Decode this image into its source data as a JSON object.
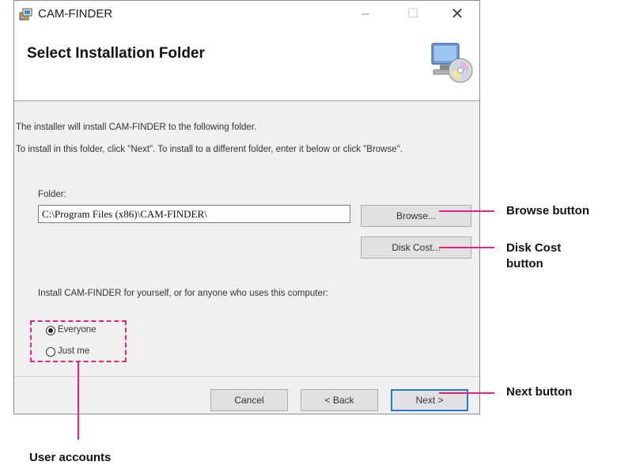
{
  "window": {
    "title": "CAM-FINDER",
    "controls": {
      "minimize": "–",
      "maximize": "☐",
      "close": "✕"
    }
  },
  "header": {
    "title": "Select Installation Folder",
    "icon": "setup-disc-icon"
  },
  "body": {
    "intro_line": "The installer will install CAM-FINDER to the following folder.",
    "instructions_line": "To install in this folder, click \"Next\". To install to a different folder, enter it below or click \"Browse\".",
    "folder_label": "Folder:",
    "folder_value": "C:\\Program Files (x86)\\CAM-FINDER\\",
    "browse_label": "Browse...",
    "disk_cost_label": "Disk Cost...",
    "install_for_text": "Install CAM-FINDER for yourself, or for anyone who uses this computer:",
    "radio_options": [
      {
        "label": "Everyone",
        "selected": true
      },
      {
        "label": "Just me",
        "selected": false
      }
    ]
  },
  "footer": {
    "cancel_label": "Cancel",
    "back_label": "< Back",
    "next_label": "Next >"
  },
  "callouts": {
    "browse": "Browse button",
    "disk_cost_line1": "Disk Cost",
    "disk_cost_line2": "button",
    "next": "Next button",
    "user_accounts": "User accounts",
    "color": "#e0237e"
  }
}
